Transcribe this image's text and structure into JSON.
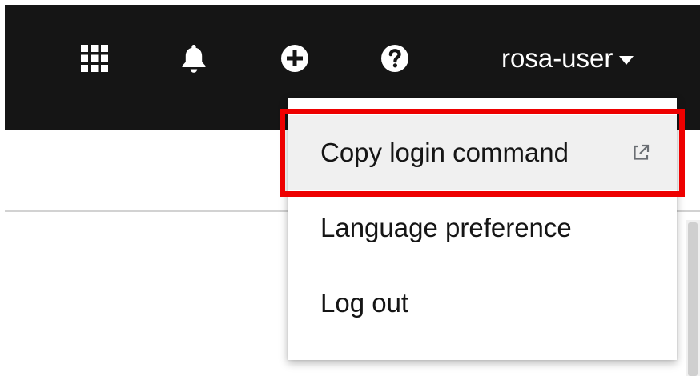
{
  "masthead": {
    "icons": [
      "apps-grid-icon",
      "bell-icon",
      "plus-circle-icon",
      "question-circle-icon"
    ],
    "user_menu": {
      "username": "rosa-user",
      "caret_icon": "caret-down-icon"
    }
  },
  "dropdown": {
    "items": [
      {
        "label": "Copy login command",
        "icon": "external-link-icon",
        "highlighted": true
      },
      {
        "label": "Language preference"
      },
      {
        "label": "Log out"
      }
    ]
  },
  "colors": {
    "masthead_bg": "#151515",
    "highlight_border": "#ee0000",
    "menu_item_hover_bg": "#f0f0f0",
    "text": "#151515"
  }
}
